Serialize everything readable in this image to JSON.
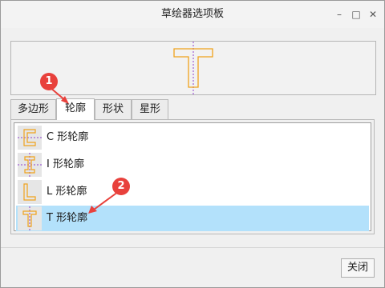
{
  "window": {
    "title": "草绘器选项板",
    "minimize_glyph": "–",
    "maximize_glyph": "□",
    "close_glyph": "✕"
  },
  "tabs": [
    {
      "label": "多边形",
      "active": false
    },
    {
      "label": "轮廓",
      "active": true
    },
    {
      "label": "形状",
      "active": false
    },
    {
      "label": "星形",
      "active": false
    }
  ],
  "list_items": [
    {
      "label": "C 形轮廓",
      "icon": "c-profile-icon",
      "selected": false
    },
    {
      "label": "I 形轮廓",
      "icon": "i-profile-icon",
      "selected": false
    },
    {
      "label": "L 形轮廓",
      "icon": "l-profile-icon",
      "selected": false
    },
    {
      "label": "T 形轮廓",
      "icon": "t-profile-icon",
      "selected": true
    }
  ],
  "buttons": {
    "close_label": "关闭"
  },
  "annotations": [
    {
      "number": "1"
    },
    {
      "number": "2"
    }
  ],
  "colors": {
    "shape_stroke": "#f0a21c",
    "selection": "#b3e1fb",
    "annotation": "#e8413c",
    "guide": "#8f3fcf"
  }
}
